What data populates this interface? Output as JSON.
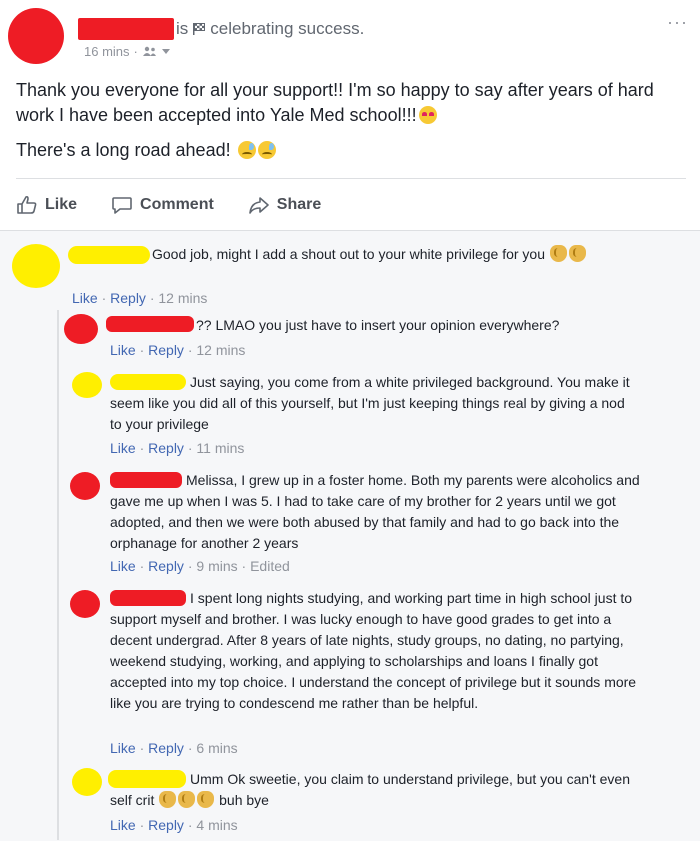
{
  "post": {
    "activity_is": "is",
    "activity_text": "celebrating success.",
    "time": "16 mins",
    "audience_icon": "friends-icon",
    "more_icon": "ellipsis-icon",
    "more_label": "···",
    "paragraph1": "Thank you everyone for all your support!! I'm so happy to say after years of hard work I have been accepted into Yale Med school!!!",
    "paragraph2": "There's a long road ahead!",
    "actions": {
      "like": "Like",
      "comment": "Comment",
      "share": "Share"
    }
  },
  "comments": [
    {
      "text": "Good job, might I add a shout out to your white privilege for you",
      "like": "Like",
      "reply": "Reply",
      "time": "12 mins",
      "avatar_color": "#ffef00"
    },
    {
      "text": "?? LMAO you just have to insert your opinion everywhere?",
      "like": "Like",
      "reply": "Reply",
      "time": "12 mins",
      "avatar_color": "#ee1c25"
    },
    {
      "text": "Just saying, you come from a white privileged background. You make it seem like you did all of this yourself, but I'm just keeping things real by giving a nod to your privilege",
      "like": "Like",
      "reply": "Reply",
      "time": "11 mins",
      "avatar_color": "#ffef00"
    },
    {
      "text": "Melissa, I grew up in a foster home. Both my parents were alcoholics and gave me up when I was 5. I had to take care of my brother for 2 years until we got adopted, and then we were both abused by that family and had to go back into the orphanage for another 2 years",
      "like": "Like",
      "reply": "Reply",
      "time": "9 mins",
      "edited": "Edited",
      "avatar_color": "#ee1c25"
    },
    {
      "text": "I spent long nights studying, and working part time in high school just to support myself and brother. I was lucky enough to have good grades to get into a decent undergrad. After 8 years of late nights, study groups, no dating, no partying, weekend studying, working, and applying to scholarships and loans I finally got accepted into my top choice. I understand the concept of privilege but it sounds more like you are trying to condescend me rather than be helpful.",
      "like": "Like",
      "reply": "Reply",
      "time": "6 mins",
      "avatar_color": "#ee1c25"
    },
    {
      "text_before": "Umm Ok sweetie, you claim to understand privilege, but you can't even self crit",
      "text_after": "buh bye",
      "like": "Like",
      "reply": "Reply",
      "time": "4 mins",
      "avatar_color": "#ffef00"
    }
  ],
  "separator": "·"
}
